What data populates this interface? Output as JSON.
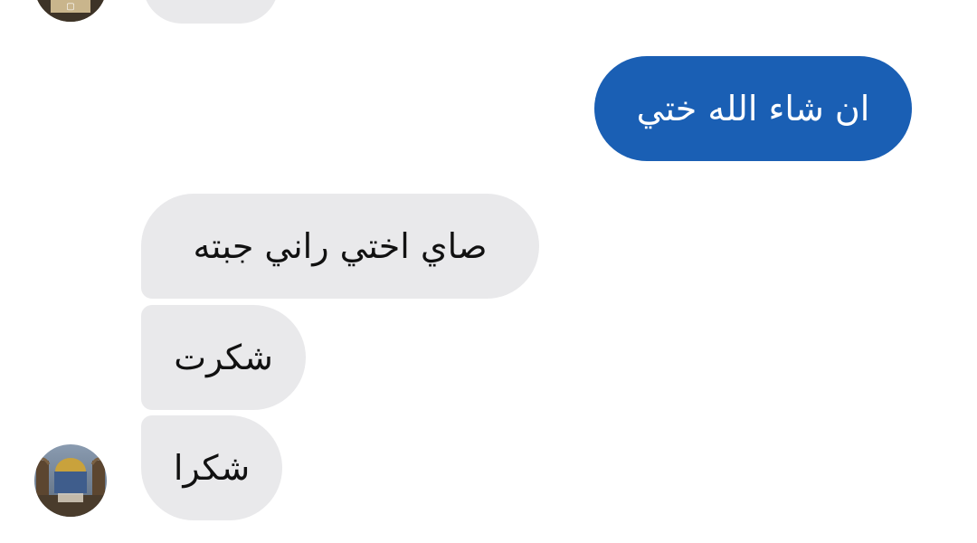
{
  "conversation": {
    "messages": [
      {
        "id": "top-partial",
        "direction": "incoming",
        "text": ""
      },
      {
        "id": "m1",
        "direction": "outgoing",
        "text": "ان شاء الله ختي"
      },
      {
        "id": "m2",
        "direction": "incoming",
        "text": "صاي اختي راني جبته"
      },
      {
        "id": "m3",
        "direction": "incoming",
        "text": "شكرت"
      },
      {
        "id": "m4",
        "direction": "incoming",
        "text": "شكرا"
      }
    ],
    "avatar": {
      "icon": "contact-avatar-icon"
    }
  },
  "colors": {
    "outgoing_bubble": "#1a5fb4",
    "incoming_bubble": "#e9e9eb",
    "background": "#ffffff"
  }
}
